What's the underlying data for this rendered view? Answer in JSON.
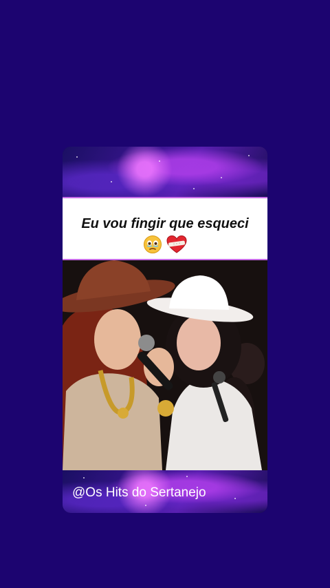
{
  "post": {
    "caption": "Eu vou fingir que esqueci",
    "caption_emojis": [
      "holding-back-tears-face-icon",
      "mending-heart-icon"
    ],
    "watermark": "@Os Hits do Sertanejo"
  },
  "colors": {
    "background": "#1c0470",
    "caption_border": "#c86de8",
    "galaxy_accent": "#a53ce6"
  }
}
